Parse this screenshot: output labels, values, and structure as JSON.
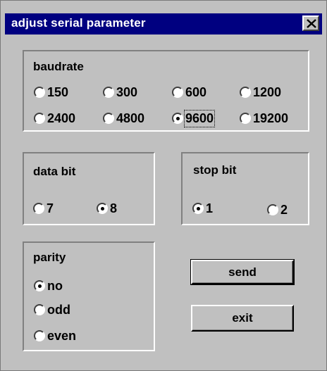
{
  "window": {
    "title": "adjust serial parameter"
  },
  "baudrate": {
    "title": "baudrate",
    "options": [
      "150",
      "300",
      "600",
      "1200",
      "2400",
      "4800",
      "9600",
      "19200"
    ],
    "selected": "9600"
  },
  "data_bit": {
    "title": "data bit",
    "options": [
      "7",
      "8"
    ],
    "selected": "8"
  },
  "stop_bit": {
    "title": "stop bit",
    "options": [
      "1",
      "2"
    ],
    "selected": "1"
  },
  "parity": {
    "title": "parity",
    "options": [
      "no",
      "odd",
      "even"
    ],
    "selected": "no"
  },
  "buttons": {
    "send": "send",
    "exit": "exit"
  },
  "icons": {
    "close": "close-icon"
  }
}
